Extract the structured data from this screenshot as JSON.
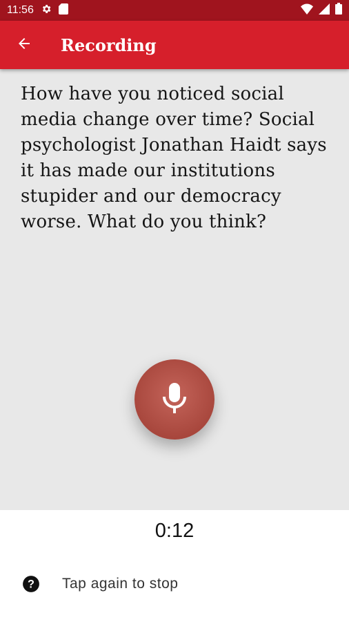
{
  "status_bar": {
    "time": "11:56",
    "icons": [
      "settings-icon",
      "sd-card-icon",
      "wifi-icon",
      "signal-icon",
      "battery-icon"
    ]
  },
  "app_bar": {
    "title": "Recording",
    "back_icon": "arrow-left-icon"
  },
  "prompt": {
    "question": "How have you noticed social media change over time? Social psychologist Jonathan Haidt says it has made our institutions stupider and our democracy worse. What do you think?"
  },
  "recorder": {
    "mic_icon": "microphone-icon",
    "elapsed": "0:12",
    "hint": "Tap again to stop",
    "hint_icon": "help-circle-icon"
  },
  "colors": {
    "status_bar": "#a0141e",
    "app_bar": "#d61f2b",
    "mic_button": "#a8473d",
    "content_bg": "#e8e8e8"
  }
}
